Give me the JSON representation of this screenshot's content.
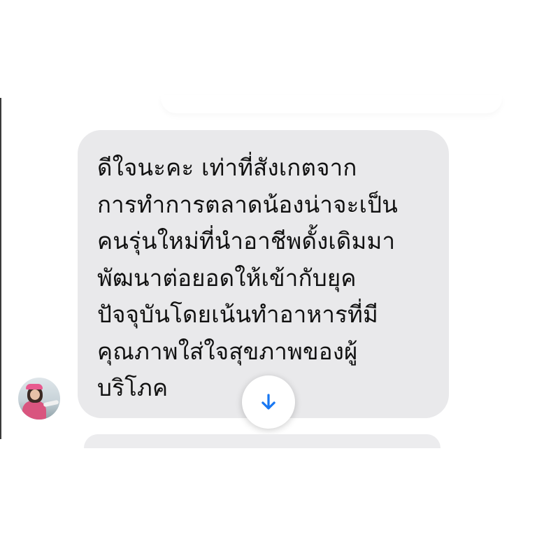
{
  "message": {
    "text": "ดีใจนะคะ เท่าที่สังเกตจาก\nการทำการตลาดน้องน่าจะเป็น\nคนรุ่นใหม่ที่นำอาชีพดั้งเดิมมา\nพัฒนาต่อยอดให้เข้ากับยุค\nปัจจุบันโดยเน้นทำอาหารที่มี\nคุณภาพใส่ใจสุขภาพของผู้\nบริโภค"
  },
  "icons": {
    "scroll_down": "arrow-down-icon",
    "avatar": "profile-photo"
  },
  "colors": {
    "bubble": "#e9e9eb",
    "text": "#111111",
    "accent": "#1877f2",
    "background": "#ffffff"
  }
}
